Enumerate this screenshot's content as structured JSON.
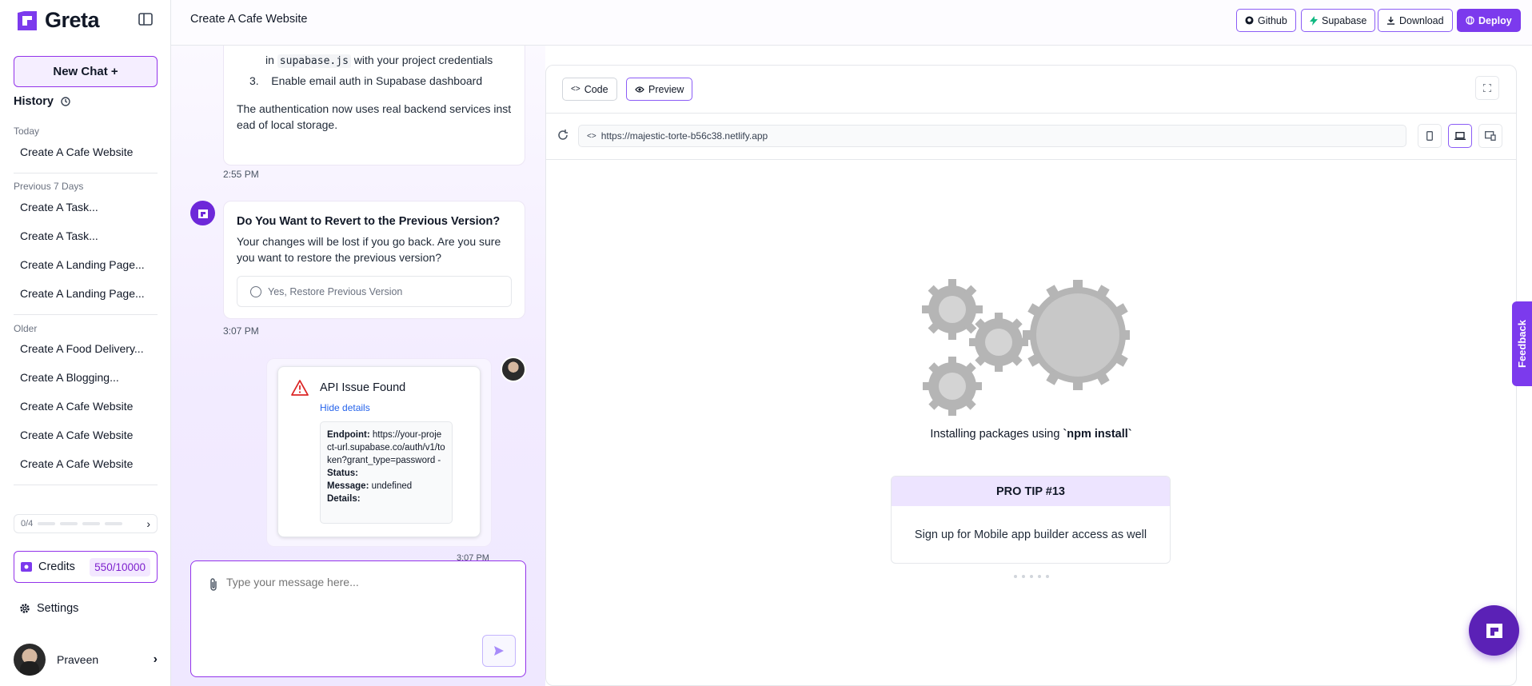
{
  "app": {
    "name": "Greta",
    "project_title": "Create A Cafe Website"
  },
  "sidebar": {
    "new_chat_label": "New Chat +",
    "history_title": "History",
    "groups": [
      {
        "label": "Today",
        "items": [
          "Create A Cafe Website"
        ]
      },
      {
        "label": "Previous 7 Days",
        "items": [
          "Create A Task...",
          "Create A Task...",
          "Create A Landing Page...",
          "Create A Landing Page..."
        ]
      },
      {
        "label": "Older",
        "items": [
          "Create A Food Delivery...",
          "Create A Blogging...",
          "Create A Cafe Website",
          "Create A Cafe Website",
          "Create A Cafe Website"
        ]
      }
    ],
    "progress_text": "0/4",
    "credits_label": "Credits",
    "credits_value": "550/10000",
    "settings_label": "Settings",
    "user_name": "Praveen"
  },
  "toolbar": {
    "github_label": "Github",
    "supabase_label": "Supabase",
    "download_label": "Download",
    "deploy_label": "Deploy"
  },
  "chat": {
    "msg1": {
      "line_prefix": "in",
      "code": "supabase.js",
      "line_suffix": "with your project credentials",
      "step_num": "3.",
      "step_text": "Enable email auth in Supabase dashboard",
      "para_line1": "The authentication now uses real backend services inst",
      "para_line2": "ead of local storage.",
      "time": "2:55 PM"
    },
    "revert": {
      "title": "Do You Want to Revert to the Previous Version?",
      "body_line1": "Your changes will be lost if you go back. Are you sure",
      "body_line2": "you want to restore the previous version?",
      "option": "Yes, Restore Previous Version",
      "time": "3:07 PM"
    },
    "api_issue": {
      "title": "API Issue Found",
      "toggle": "Hide details",
      "endpoint_label": "Endpoint:",
      "endpoint_value": "https://your-project-url.supabase.co/auth/v1/token?grant_type=password -",
      "status_label": "Status:",
      "message_label": "Message:",
      "message_value": "undefined",
      "details_label": "Details:",
      "time": "3:07 PM"
    },
    "input_placeholder": "Type your message here..."
  },
  "preview": {
    "tab_code": "Code",
    "tab_preview": "Preview",
    "url": "https://majestic-torte-b56c38.netlify.app",
    "installing_prefix": "Installing packages using ",
    "installing_cmd": "`npm install`",
    "tip_title": "PRO TIP #13",
    "tip_body": "Sign up for Mobile app builder access as well"
  },
  "feedback_label": "Feedback",
  "colors": {
    "accent": "#7c3aed",
    "accent_light": "#ede4ff",
    "gear": "#b5b5b5"
  }
}
